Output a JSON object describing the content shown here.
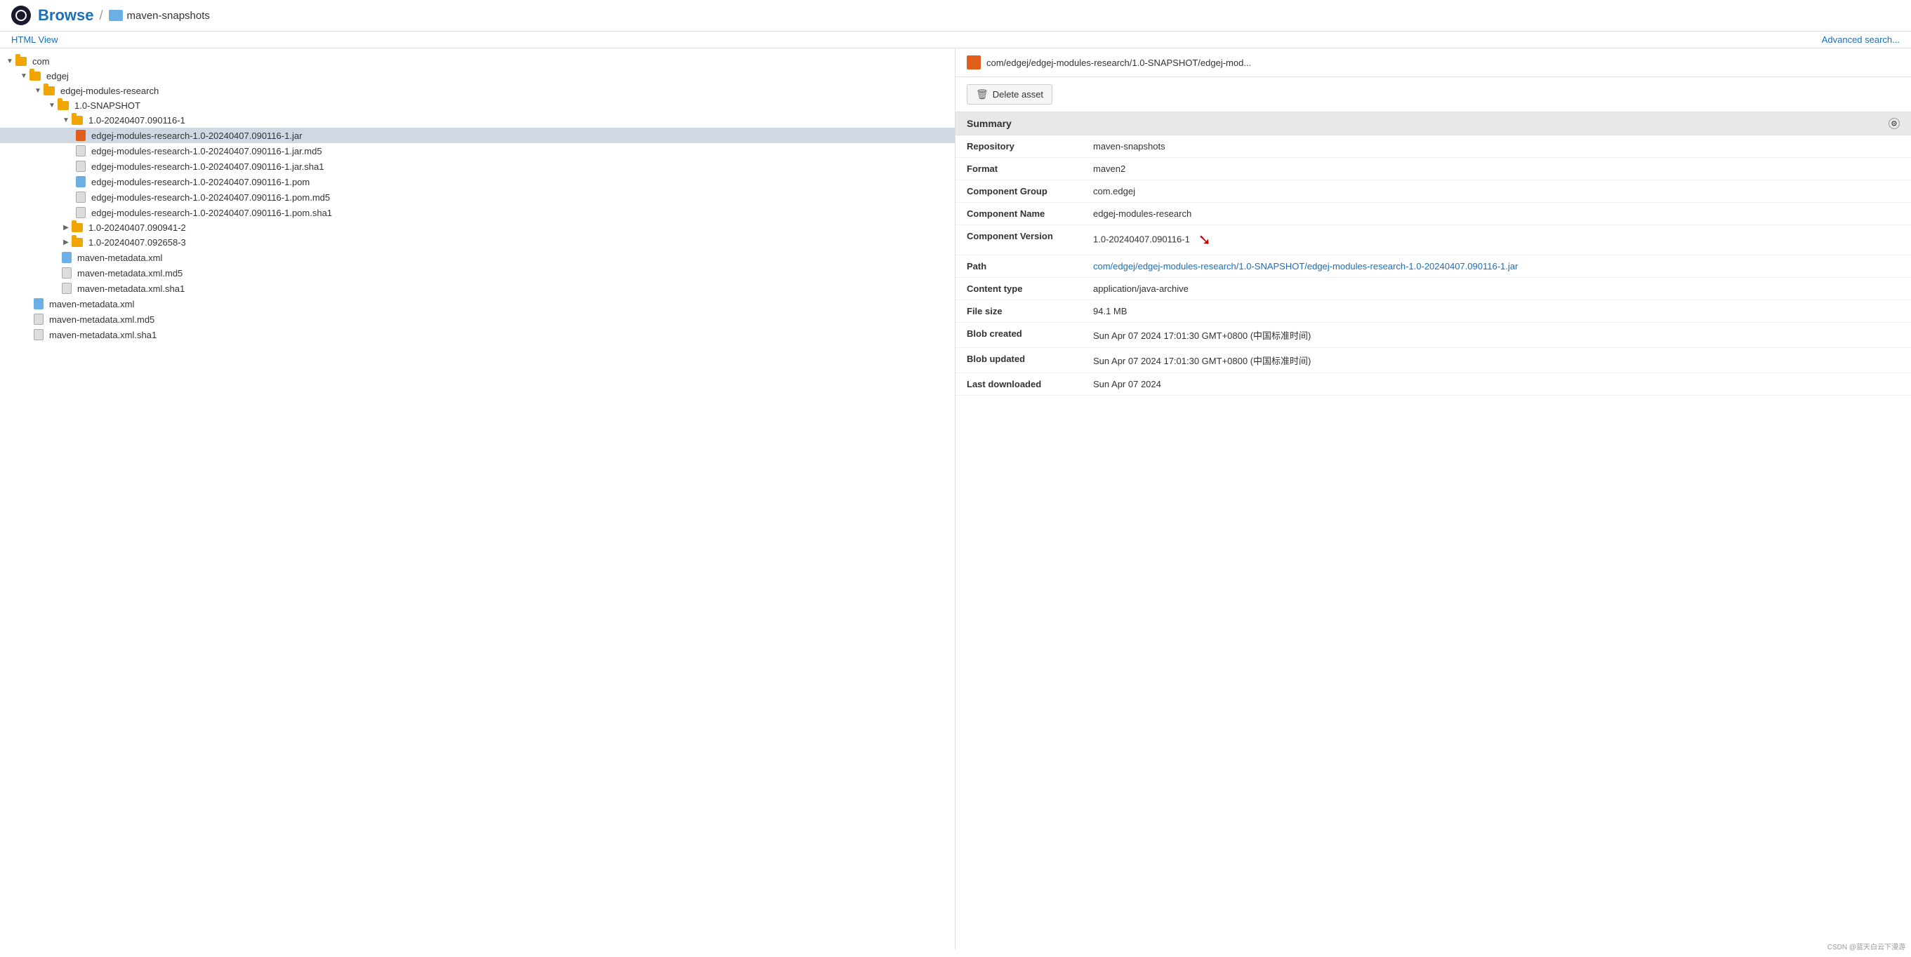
{
  "header": {
    "logo_label": "Nexus",
    "title": "Browse",
    "separator": "/",
    "repo_name": "maven-snapshots"
  },
  "navbar": {
    "html_view_label": "HTML View",
    "advanced_search_label": "Advanced search..."
  },
  "tree": {
    "items": [
      {
        "id": "com",
        "label": "com",
        "type": "folder",
        "level": 0,
        "expanded": true,
        "expand_symbol": "▼"
      },
      {
        "id": "edgej",
        "label": "edgej",
        "type": "folder",
        "level": 1,
        "expanded": true,
        "expand_symbol": "▼"
      },
      {
        "id": "edgej-modules-research",
        "label": "edgej-modules-research",
        "type": "folder",
        "level": 2,
        "expanded": true,
        "expand_symbol": "▼"
      },
      {
        "id": "1.0-SNAPSHOT",
        "label": "1.0-SNAPSHOT",
        "type": "folder",
        "level": 3,
        "expanded": true,
        "expand_symbol": "▼"
      },
      {
        "id": "1.0-20240407.090116-1-folder",
        "label": "1.0-20240407.090116-1",
        "type": "folder",
        "level": 4,
        "expanded": true,
        "expand_symbol": "▼"
      },
      {
        "id": "jar-file",
        "label": "edgej-modules-research-1.0-20240407.090116-1.jar",
        "type": "jar",
        "level": 5,
        "selected": true
      },
      {
        "id": "jar-md5",
        "label": "edgej-modules-research-1.0-20240407.090116-1.jar.md5",
        "type": "md5",
        "level": 5
      },
      {
        "id": "jar-sha1",
        "label": "edgej-modules-research-1.0-20240407.090116-1.jar.sha1",
        "type": "sha1",
        "level": 5
      },
      {
        "id": "pom-file",
        "label": "edgej-modules-research-1.0-20240407.090116-1.pom",
        "type": "pom",
        "level": 5
      },
      {
        "id": "pom-md5",
        "label": "edgej-modules-research-1.0-20240407.090116-1.pom.md5",
        "type": "md5",
        "level": 5
      },
      {
        "id": "pom-sha1",
        "label": "edgej-modules-research-1.0-20240407.090116-1.pom.sha1",
        "type": "sha1",
        "level": 5
      },
      {
        "id": "1.0-20240407.090941-2-folder",
        "label": "1.0-20240407.090941-2",
        "type": "folder",
        "level": 4,
        "expanded": false,
        "expand_symbol": "▶"
      },
      {
        "id": "1.0-20240407.092658-3-folder",
        "label": "1.0-20240407.092658-3",
        "type": "folder",
        "level": 4,
        "expanded": false,
        "expand_symbol": "▶"
      },
      {
        "id": "maven-metadata-xml",
        "label": "maven-metadata.xml",
        "type": "xml-blue",
        "level": 4
      },
      {
        "id": "maven-metadata-md5",
        "label": "maven-metadata.xml.md5",
        "type": "md5",
        "level": 4
      },
      {
        "id": "maven-metadata-sha1",
        "label": "maven-metadata.xml.sha1",
        "type": "sha1",
        "level": 4
      },
      {
        "id": "root-maven-metadata-xml",
        "label": "maven-metadata.xml",
        "type": "xml-blue",
        "level": 2
      },
      {
        "id": "root-maven-metadata-md5",
        "label": "maven-metadata.xml.md5",
        "type": "md5",
        "level": 2
      },
      {
        "id": "root-maven-metadata-sha1",
        "label": "maven-metadata.xml.sha1",
        "type": "sha1",
        "level": 2
      }
    ]
  },
  "asset_panel": {
    "header_title": "com/edgej/edgej-modules-research/1.0-SNAPSHOT/edgej-mod...",
    "delete_button_label": "Delete asset",
    "summary_header": "Summary",
    "fields": [
      {
        "key": "repository",
        "label": "Repository",
        "value": "maven-snapshots",
        "type": "text"
      },
      {
        "key": "format",
        "label": "Format",
        "value": "maven2",
        "type": "text"
      },
      {
        "key": "component_group",
        "label": "Component Group",
        "value": "com.edgej",
        "type": "text"
      },
      {
        "key": "component_name",
        "label": "Component Name",
        "value": "edgej-modules-research",
        "type": "text"
      },
      {
        "key": "component_version",
        "label": "Component Version",
        "value": "1.0-20240407.090116-1",
        "type": "text",
        "has_arrow": true
      },
      {
        "key": "path",
        "label": "Path",
        "value": "com/edgej/edgej-modules-research/1.0-SNAPSHOT/edgej-modules-research-1.0-20240407.090116-1.jar",
        "type": "link"
      },
      {
        "key": "content_type",
        "label": "Content type",
        "value": "application/java-archive",
        "type": "text"
      },
      {
        "key": "file_size",
        "label": "File size",
        "value": "94.1 MB",
        "type": "text"
      },
      {
        "key": "blob_created",
        "label": "Blob created",
        "value": "Sun Apr 07 2024 17:01:30 GMT+0800 (中国标准时间)",
        "type": "text"
      },
      {
        "key": "blob_updated",
        "label": "Blob updated",
        "value": "Sun Apr 07 2024 17:01:30 GMT+0800 (中国标准时间)",
        "type": "text"
      },
      {
        "key": "last_downloaded",
        "label": "Last downloaded",
        "value": "Sun Apr 07 2024",
        "type": "text"
      }
    ]
  },
  "footer": {
    "watermark": "CSDN @蓝天白云下漫游"
  }
}
